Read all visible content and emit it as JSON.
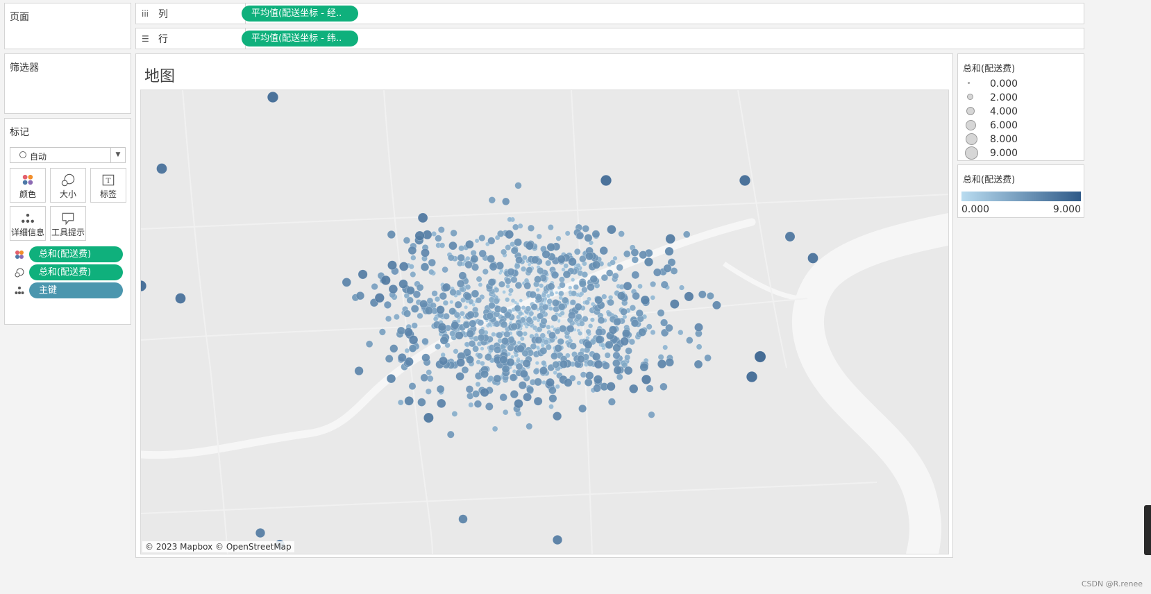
{
  "pages_panel": {
    "title": "页面"
  },
  "columns_shelf": {
    "label": "列",
    "icon": "columns-icon",
    "pill": "平均值(配送坐标 - 经.."
  },
  "rows_shelf": {
    "label": "行",
    "icon": "rows-icon",
    "pill": "平均值(配送坐标 - 纬.."
  },
  "filters_panel": {
    "title": "筛选器"
  },
  "marks_panel": {
    "title": "标记",
    "mark_type": "自动",
    "buttons": [
      {
        "label": "颜色",
        "icon": "color-icon"
      },
      {
        "label": "大小",
        "icon": "size-icon"
      },
      {
        "label": "标签",
        "icon": "label-icon"
      },
      {
        "label": "详细信息",
        "icon": "detail-icon"
      },
      {
        "label": "工具提示",
        "icon": "tooltip-icon"
      }
    ],
    "fields": [
      {
        "icon": "color-icon",
        "label": "总和(配送费)",
        "color": "#0fb07c"
      },
      {
        "icon": "size-icon",
        "label": "总和(配送费)",
        "color": "#0fb07c"
      },
      {
        "icon": "detail-icon",
        "label": "主键",
        "color": "#4b96ae"
      }
    ]
  },
  "viz": {
    "title": "地图",
    "attribution": "© 2023 Mapbox © OpenStreetMap"
  },
  "size_legend": {
    "title": "总和(配送费)",
    "items": [
      "0.000",
      "2.000",
      "4.000",
      "6.000",
      "8.000",
      "9.000"
    ]
  },
  "color_legend": {
    "title": "总和(配送费)",
    "min_label": "0.000",
    "max_label": "9.000",
    "min_color": "#b9dcf0",
    "max_color": "#2f5a88"
  },
  "watermark": "CSDN @R.renee"
}
